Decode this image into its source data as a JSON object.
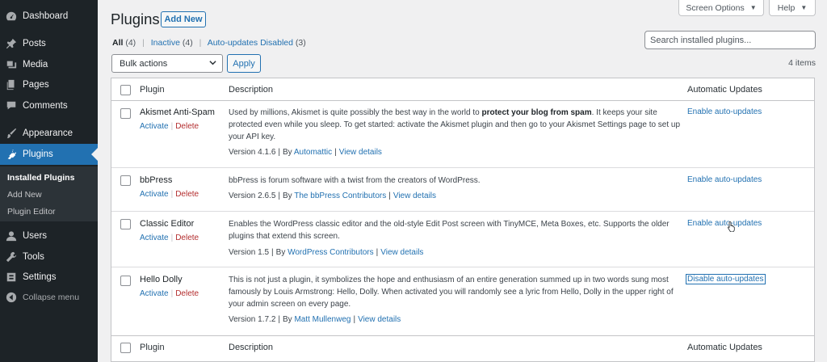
{
  "sidebar": {
    "items": [
      {
        "label": "Dashboard",
        "icon": "dashboard-icon"
      },
      {
        "label": "Posts",
        "icon": "pushpin-icon"
      },
      {
        "label": "Media",
        "icon": "media-icon"
      },
      {
        "label": "Pages",
        "icon": "pages-icon"
      },
      {
        "label": "Comments",
        "icon": "comment-icon"
      },
      {
        "label": "Appearance",
        "icon": "paintbrush-icon"
      },
      {
        "label": "Plugins",
        "icon": "plugin-icon"
      },
      {
        "label": "Users",
        "icon": "user-icon"
      },
      {
        "label": "Tools",
        "icon": "wrench-icon"
      },
      {
        "label": "Settings",
        "icon": "settings-icon"
      },
      {
        "label": "Collapse menu",
        "icon": "collapse-icon"
      }
    ],
    "submenu": [
      "Installed Plugins",
      "Add New",
      "Plugin Editor"
    ]
  },
  "top_buttons": {
    "screen_options": "Screen Options",
    "help": "Help"
  },
  "header": {
    "title": "Plugins",
    "add_new": "Add New"
  },
  "filters": {
    "all": "All",
    "all_count": "(4)",
    "inactive": "Inactive",
    "inactive_count": "(4)",
    "auto_disabled": "Auto-updates Disabled",
    "auto_disabled_count": "(3)",
    "separator": "|"
  },
  "search": {
    "placeholder": "Search installed plugins..."
  },
  "bulk": {
    "label": "Bulk actions",
    "apply": "Apply",
    "items_count": "4 items"
  },
  "table": {
    "columns": {
      "plugin": "Plugin",
      "description": "Description",
      "auto": "Automatic Updates"
    },
    "rows": [
      {
        "name": "Akismet Anti-Spam",
        "activate": "Activate",
        "delete": "Delete",
        "desc_a": "Used by millions, Akismet is quite possibly the best way in the world to ",
        "desc_bold": "protect your blog from spam",
        "desc_b": ". It keeps your site protected even while you sleep. To get started: activate the Akismet plugin and then go to your Akismet Settings page to set up your API key.",
        "version": "Version 4.1.6",
        "by": "By",
        "author": "Automattic",
        "view": "View details",
        "auto": "Enable auto-updates"
      },
      {
        "name": "bbPress",
        "activate": "Activate",
        "delete": "Delete",
        "desc": "bbPress is forum software with a twist from the creators of WordPress.",
        "version": "Version 2.6.5",
        "by": "By",
        "author": "The bbPress Contributors",
        "view": "View details",
        "auto": "Enable auto-updates"
      },
      {
        "name": "Classic Editor",
        "activate": "Activate",
        "delete": "Delete",
        "desc": "Enables the WordPress classic editor and the old-style Edit Post screen with TinyMCE, Meta Boxes, etc. Supports the older plugins that extend this screen.",
        "version": "Version 1.5",
        "by": "By",
        "author": "WordPress Contributors",
        "view": "View details",
        "auto": "Enable auto-updates"
      },
      {
        "name": "Hello Dolly",
        "activate": "Activate",
        "delete": "Delete",
        "desc": "This is not just a plugin, it symbolizes the hope and enthusiasm of an entire generation summed up in two words sung most famously by Louis Armstrong: Hello, Dolly. When activated you will randomly see a lyric from Hello, Dolly in the upper right of your admin screen on every page.",
        "version": "Version 1.7.2",
        "by": "By",
        "author": "Matt Mullenweg",
        "view": "View details",
        "auto": "Disable auto-updates"
      }
    ]
  },
  "colors": {
    "sidebar_bg": "#1d2327",
    "active": "#2271b1",
    "link": "#2271b1",
    "delete": "#b32d2e"
  }
}
